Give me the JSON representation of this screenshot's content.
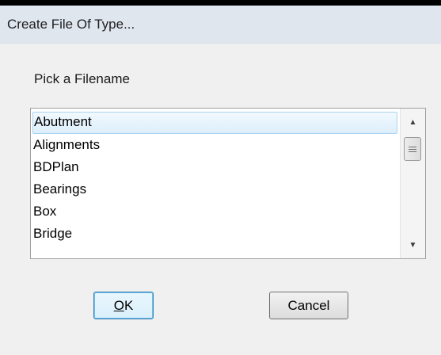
{
  "dialog": {
    "title": "Create File Of Type...",
    "prompt": "Pick a Filename"
  },
  "filename_list": {
    "items": [
      {
        "label": "Abutment",
        "selected": true
      },
      {
        "label": "Alignments",
        "selected": false
      },
      {
        "label": "BDPlan",
        "selected": false
      },
      {
        "label": "Bearings",
        "selected": false
      },
      {
        "label": "Box",
        "selected": false
      },
      {
        "label": "Bridge",
        "selected": false
      }
    ],
    "scrollbar": {
      "up_icon": "triangle-up",
      "down_icon": "triangle-down",
      "up_glyph": "▲",
      "down_glyph": "▼"
    }
  },
  "buttons": {
    "ok_mnemonic": "O",
    "ok_rest": "K",
    "cancel_label": "Cancel"
  },
  "colors": {
    "title_bar": "#dfe6ee",
    "selection_border": "#a9d3f0",
    "default_button_border": "#3c7fb1"
  }
}
